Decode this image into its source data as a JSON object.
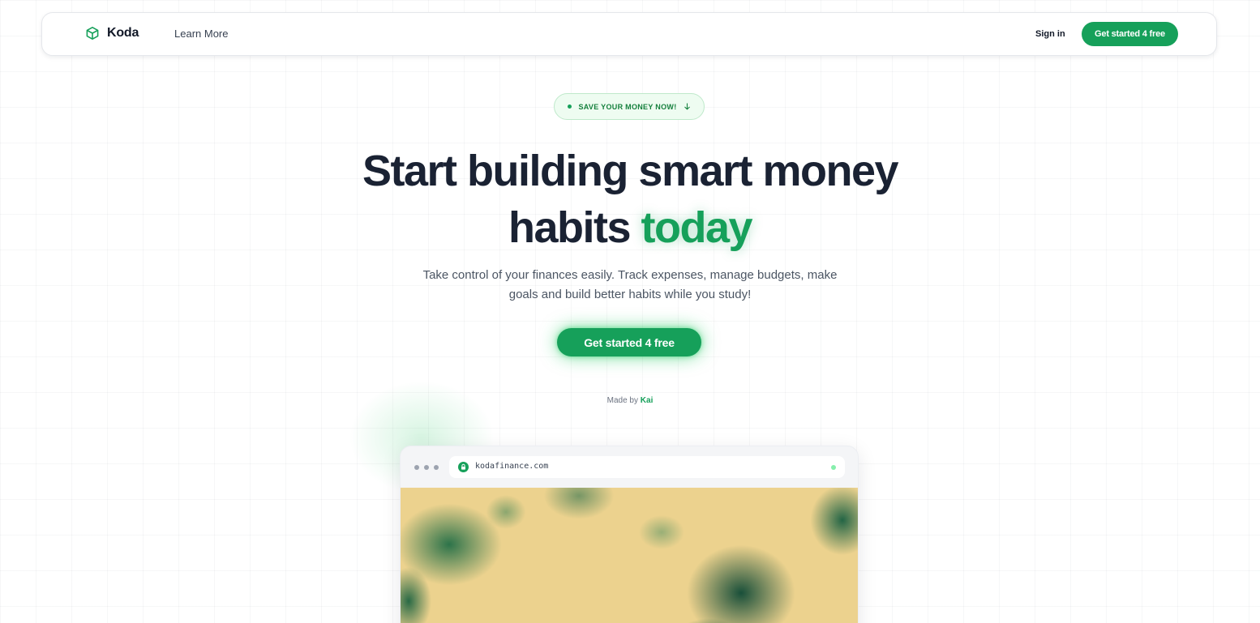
{
  "nav": {
    "brand": "Koda",
    "learn_more": "Learn More",
    "sign_in": "Sign in",
    "cta": "Get started 4 free"
  },
  "badge": {
    "text": "SAVE YOUR MONEY NOW!"
  },
  "hero": {
    "title_line1": "Start building smart money",
    "title_line2_start": "habits",
    "title_line2_accent": "today",
    "subtitle": "Take control of your finances easily. Track expenses, manage budgets, make goals and build better habits while you study!",
    "cta": "Get started 4 free",
    "credit_prefix": "Made by",
    "credit_author": "Kai"
  },
  "browser": {
    "url": "kodafinance.com"
  },
  "colors": {
    "accent": "#16a05a",
    "text": "#1a2233",
    "muted": "#4b5563",
    "badge_bg": "#eefcf1"
  },
  "icons": {
    "brand": "cube-logo-icon",
    "badge_dot": "dot-icon",
    "badge_arrow": "arrow-down-icon",
    "url_lock": "lock-icon",
    "window_controls": "window-dots-icon",
    "status": "status-dot-icon"
  }
}
